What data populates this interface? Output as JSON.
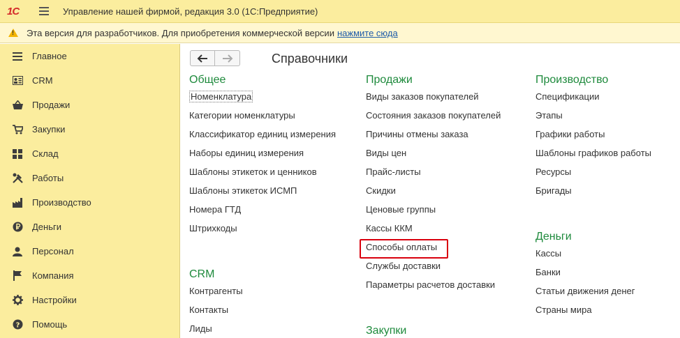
{
  "titlebar": {
    "logo": "1С",
    "title": "Управление нашей фирмой, редакция 3.0  (1С:Предприятие)"
  },
  "devbar": {
    "text": "Эта версия для разработчиков. Для приобретения коммерческой версии",
    "link": "нажмите сюда"
  },
  "sidebar": {
    "items": [
      {
        "label": "Главное",
        "icon": "menu-list-icon"
      },
      {
        "label": "CRM",
        "icon": "contact-card-icon"
      },
      {
        "label": "Продажи",
        "icon": "shopping-basket-icon"
      },
      {
        "label": "Закупки",
        "icon": "cart-icon"
      },
      {
        "label": "Склад",
        "icon": "warehouse-grid-icon"
      },
      {
        "label": "Работы",
        "icon": "tools-icon"
      },
      {
        "label": "Производство",
        "icon": "factory-icon"
      },
      {
        "label": "Деньги",
        "icon": "ruble-coin-icon"
      },
      {
        "label": "Персонал",
        "icon": "person-icon"
      },
      {
        "label": "Компания",
        "icon": "flag-icon"
      },
      {
        "label": "Настройки",
        "icon": "gear-icon"
      },
      {
        "label": "Помощь",
        "icon": "help-icon"
      }
    ]
  },
  "content": {
    "title": "Справочники",
    "back": "🡐",
    "forward": "🡒",
    "sections": {
      "general": {
        "title": "Общее",
        "links": [
          "Номенклатура",
          "Категории номенклатуры",
          "Классификатор единиц измерения",
          "Наборы единиц измерения",
          "Шаблоны этикеток и ценников",
          "Шаблоны этикеток ИСМП",
          "Номера ГТД",
          "Штрихкоды"
        ]
      },
      "crm": {
        "title": "CRM",
        "links": [
          "Контрагенты",
          "Контакты",
          "Лиды"
        ]
      },
      "sales": {
        "title": "Продажи",
        "links": [
          "Виды заказов покупателей",
          "Состояния заказов покупателей",
          "Причины отмены заказа",
          "Виды цен",
          "Прайс-листы",
          "Скидки",
          "Ценовые группы",
          "Кассы ККМ",
          "Способы оплаты",
          "Службы доставки",
          "Параметры расчетов доставки"
        ]
      },
      "purchases": {
        "title": "Закупки"
      },
      "production": {
        "title": "Производство",
        "links": [
          "Спецификации",
          "Этапы",
          "Графики работы",
          "Шаблоны графиков работы",
          "Ресурсы",
          "Бригады"
        ]
      },
      "money": {
        "title": "Деньги",
        "links": [
          "Кассы",
          "Банки",
          "Статьи движения денег",
          "Страны мира"
        ]
      }
    }
  }
}
